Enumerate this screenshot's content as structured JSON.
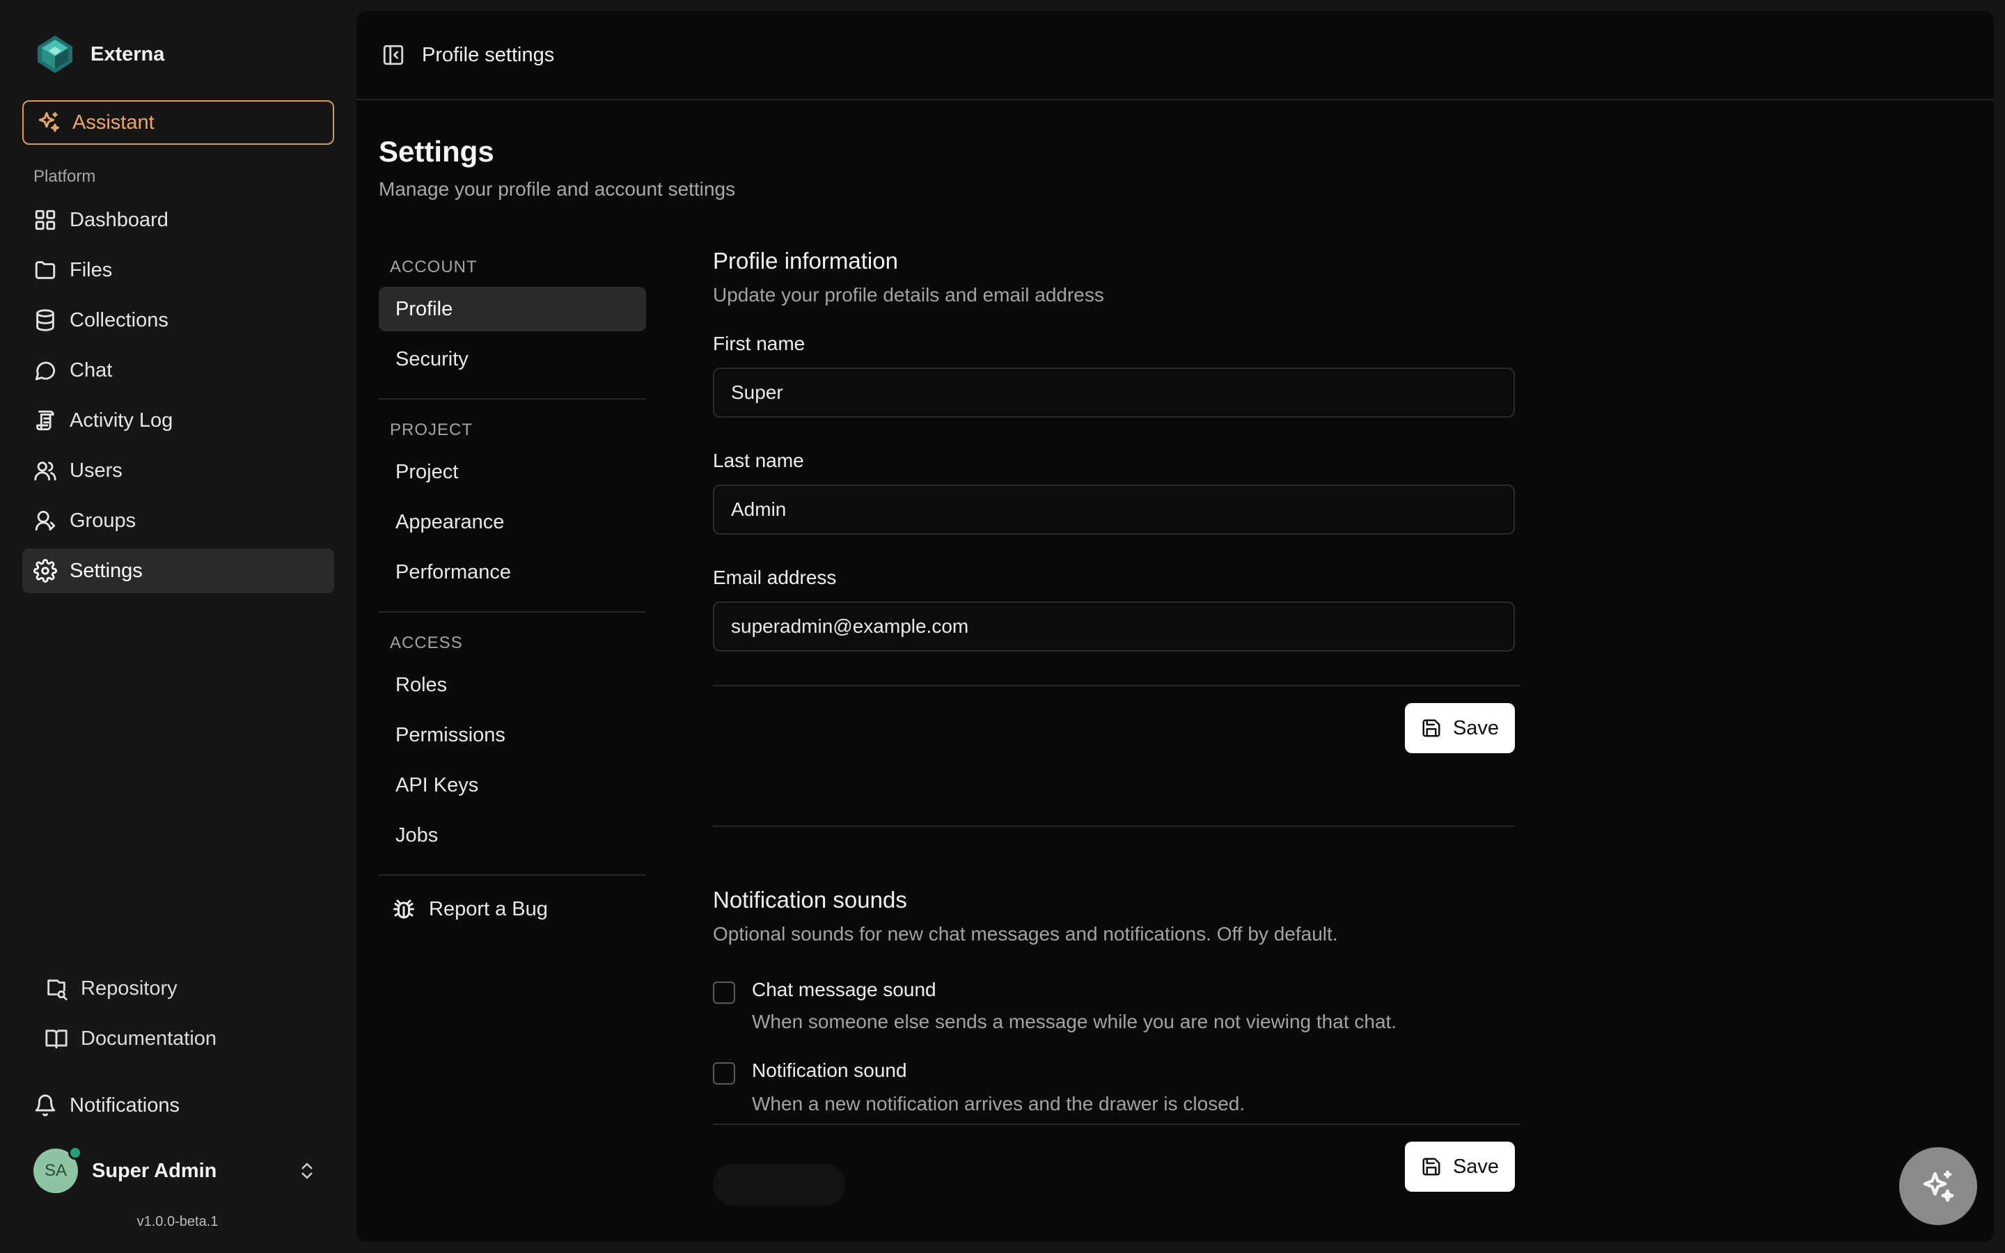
{
  "app": {
    "name": "Externa",
    "version": "v1.0.0-beta.1"
  },
  "sidebar": {
    "assistant_label": "Assistant",
    "section_label": "Platform",
    "items": [
      {
        "label": "Dashboard",
        "icon": "grid-icon",
        "active": false
      },
      {
        "label": "Files",
        "icon": "folder-icon",
        "active": false
      },
      {
        "label": "Collections",
        "icon": "database-icon",
        "active": false
      },
      {
        "label": "Chat",
        "icon": "chat-bubble-icon",
        "active": false
      },
      {
        "label": "Activity Log",
        "icon": "scroll-icon",
        "active": false
      },
      {
        "label": "Users",
        "icon": "users-icon",
        "active": false
      },
      {
        "label": "Groups",
        "icon": "group-icon",
        "active": false
      },
      {
        "label": "Settings",
        "icon": "gear-icon",
        "active": true
      }
    ],
    "footer_links": [
      {
        "label": "Repository",
        "icon": "repository-icon"
      },
      {
        "label": "Documentation",
        "icon": "book-icon"
      }
    ],
    "notifications_label": "Notifications",
    "user": {
      "initials": "SA",
      "name": "Super Admin",
      "online": true
    }
  },
  "topbar": {
    "title": "Profile settings"
  },
  "page": {
    "title": "Settings",
    "subtitle": "Manage your profile and account settings"
  },
  "subnav": {
    "groups": [
      {
        "label": "ACCOUNT",
        "items": [
          "Profile",
          "Security"
        ],
        "active": "Profile"
      },
      {
        "label": "PROJECT",
        "items": [
          "Project",
          "Appearance",
          "Performance"
        ]
      },
      {
        "label": "ACCESS",
        "items": [
          "Roles",
          "Permissions",
          "API Keys",
          "Jobs"
        ]
      }
    ],
    "report_bug_label": "Report a Bug"
  },
  "profile": {
    "title": "Profile information",
    "subtitle": "Update your profile details and email address",
    "first_name_label": "First name",
    "first_name_value": "Super",
    "last_name_label": "Last name",
    "last_name_value": "Admin",
    "email_label": "Email address",
    "email_value": "superadmin@example.com",
    "save_label": "Save"
  },
  "notification_sounds": {
    "title": "Notification sounds",
    "subtitle": "Optional sounds for new chat messages and notifications. Off by default.",
    "chat_sound_label": "Chat message sound",
    "chat_sound_desc": "When someone else sends a message while you are not viewing that chat.",
    "chat_sound_checked": false,
    "notif_sound_label": "Notification sound",
    "notif_sound_desc": "When a new notification arrives and the drawer is closed.",
    "notif_sound_checked": false,
    "save_label": "Save"
  },
  "colors": {
    "accent": "#e09a59",
    "online": "#22a07b",
    "background": "#161616",
    "panel": "#0a0a0a"
  }
}
